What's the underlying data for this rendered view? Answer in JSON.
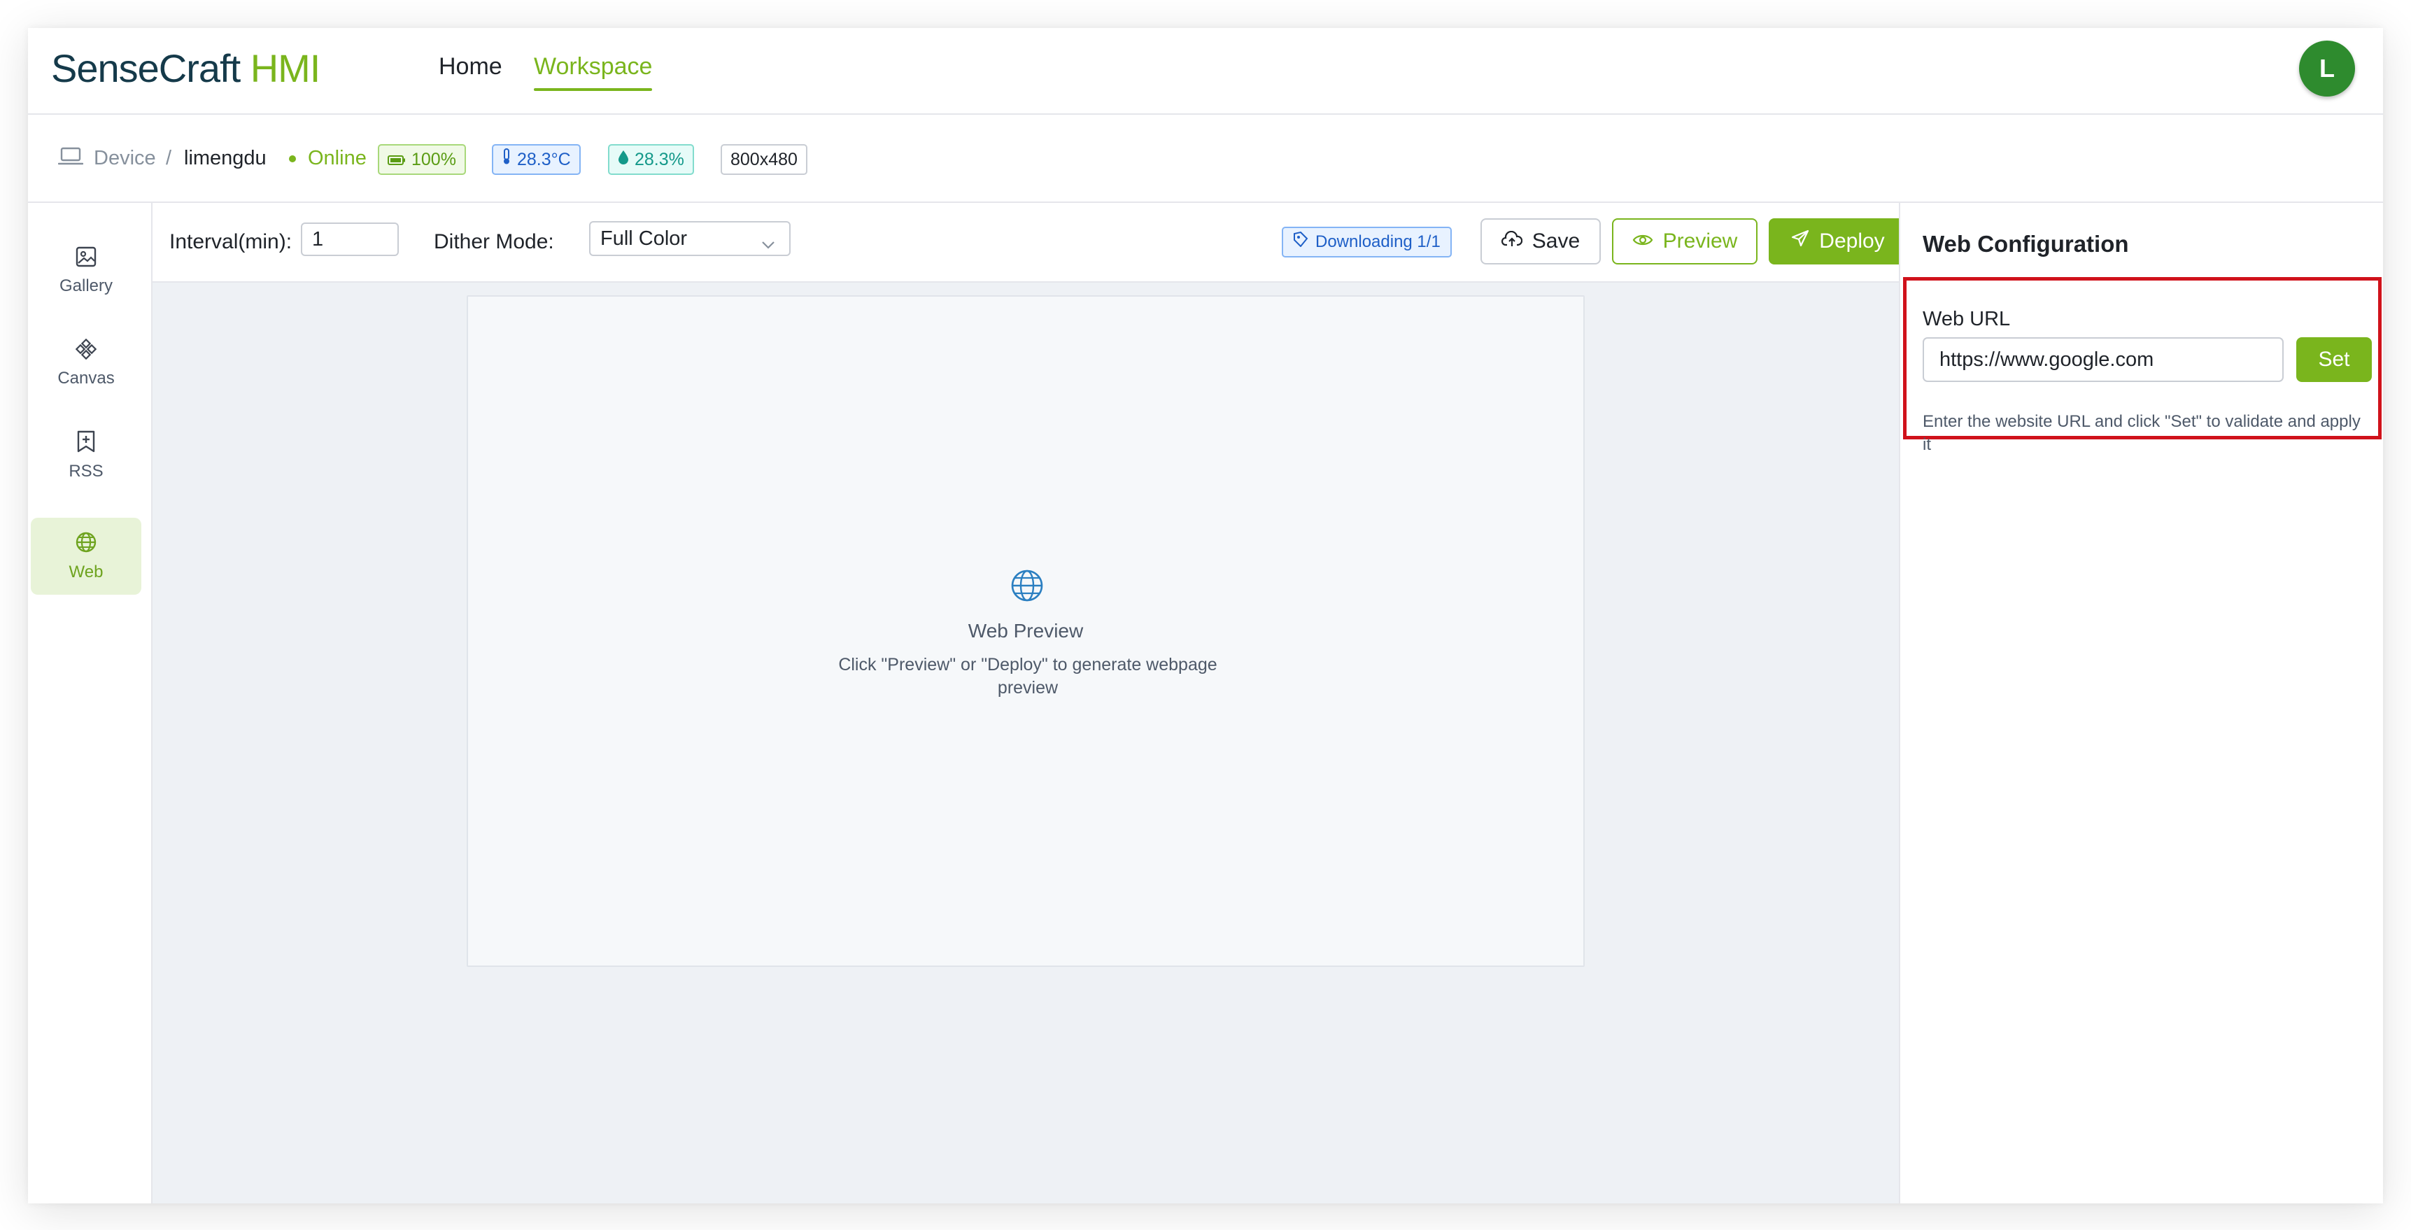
{
  "header": {
    "logo_part1": "SenseCraft",
    "logo_part2": " HMI",
    "nav": [
      {
        "label": "Home",
        "active": false
      },
      {
        "label": "Workspace",
        "active": true
      }
    ],
    "avatar_initial": "L"
  },
  "device": {
    "label": "Device",
    "separator": "/",
    "name": "limengdu",
    "status": "Online",
    "battery": "100%",
    "temperature": "28.3°C",
    "humidity": "28.3%",
    "resolution": "800x480"
  },
  "sidebar": {
    "items": [
      {
        "label": "Gallery",
        "icon": "image-icon",
        "active": false
      },
      {
        "label": "Canvas",
        "icon": "canvas-icon",
        "active": false
      },
      {
        "label": "RSS",
        "icon": "rss-icon",
        "active": false
      },
      {
        "label": "Web",
        "icon": "globe-icon",
        "active": true
      }
    ]
  },
  "toolbar": {
    "interval_label": "Interval(min):",
    "interval_value": "1",
    "dither_label": "Dither Mode:",
    "dither_value": "Full Color",
    "downloading": "Downloading 1/1",
    "save_label": "Save",
    "preview_label": "Preview",
    "deploy_label": "Deploy"
  },
  "preview": {
    "title": "Web Preview",
    "description": "Click \"Preview\" or \"Deploy\" to generate webpage preview"
  },
  "web_config": {
    "title": "Web Configuration",
    "url_label": "Web URL",
    "url_value": "https://www.google.com",
    "set_label": "Set",
    "help": "Enter the website URL and click \"Set\" to validate and apply it"
  },
  "colors": {
    "brand_green": "#7ab51d",
    "brand_dark": "#153a4a",
    "highlight_red": "#d0121b"
  }
}
